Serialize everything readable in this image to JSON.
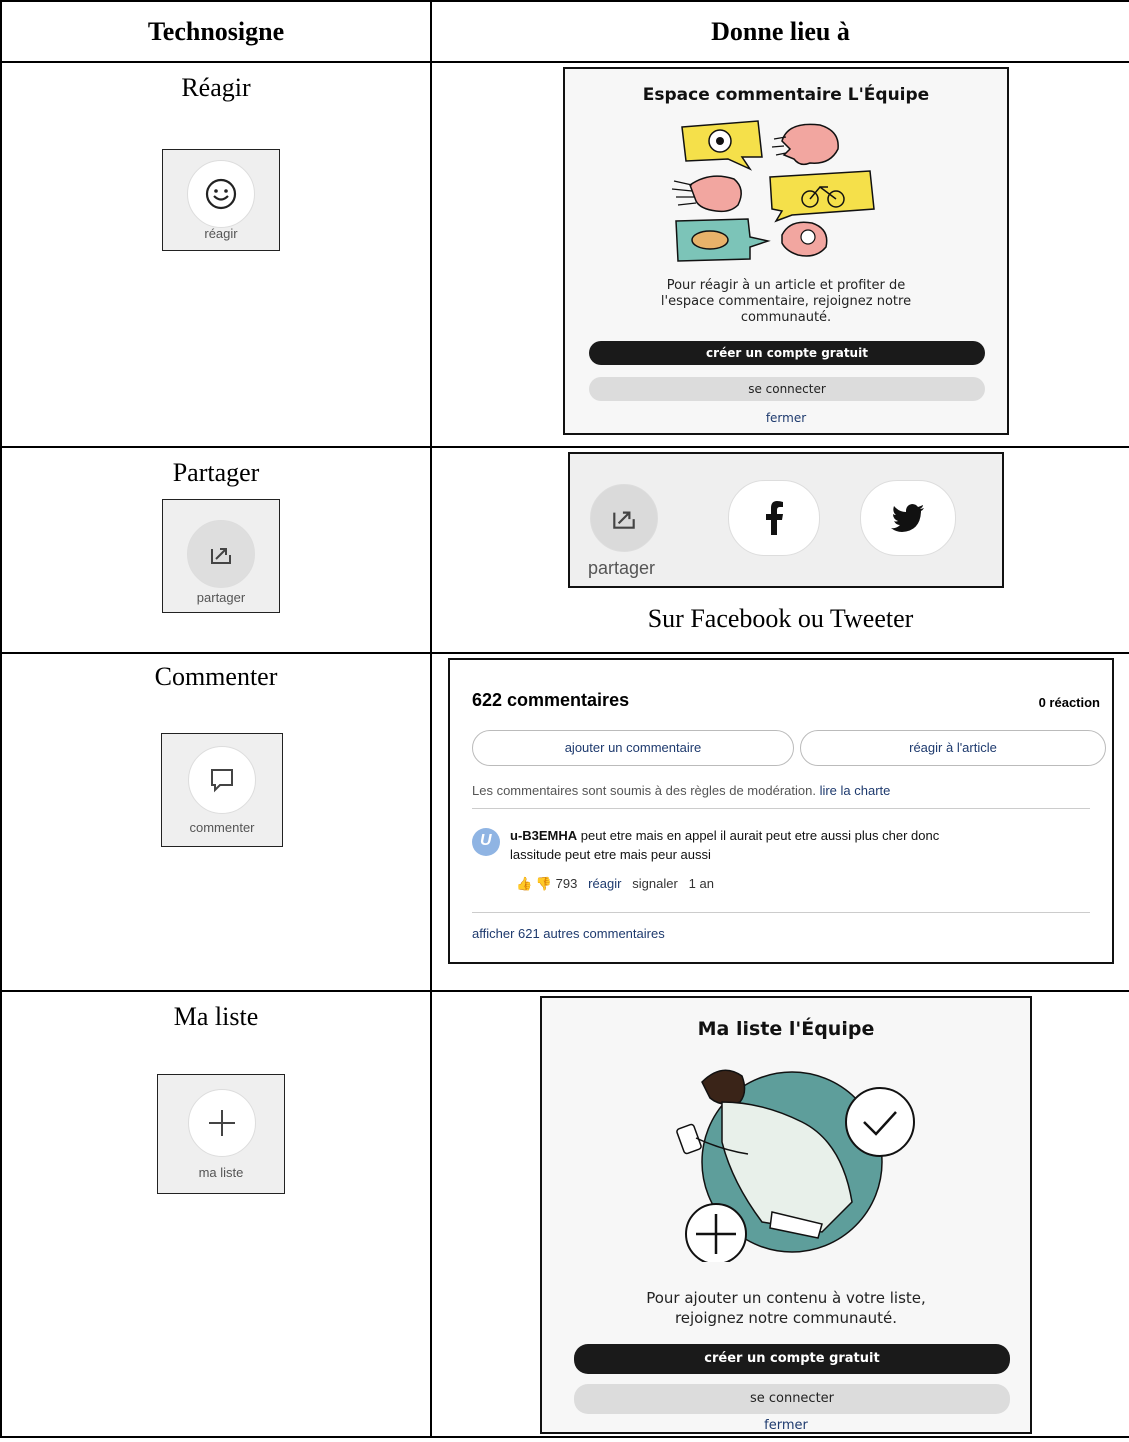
{
  "table": {
    "col1_header": "Technosigne",
    "col2_header": "Donne lieu à"
  },
  "rows": [
    {
      "label": "Réagir",
      "tech_label": "réagir",
      "panel": {
        "title": "Espace commentaire L'Équipe",
        "text": [
          "Pour réagir à un article et profiter de",
          "l'espace commentaire, rejoignez notre",
          "communauté."
        ],
        "primary_button": "créer un compte gratuit",
        "secondary_button": "se connecter",
        "close_link": "fermer"
      }
    },
    {
      "label": "Partager",
      "tech_label": "partager",
      "share": {
        "label": "partager",
        "facebook_icon": "facebook-icon",
        "twitter_icon": "twitter-icon"
      },
      "caption": "Sur Facebook ou Tweeter"
    },
    {
      "label": "Commenter",
      "tech_label": "commenter",
      "comments": {
        "count": "622 commentaires",
        "reactions": "0 réaction",
        "add_button": "ajouter un commentaire",
        "react_button": "réagir à l'article",
        "moderation_text": "Les commentaires sont soumis à des règles de modération.",
        "charter_link": "lire la charte",
        "comment": {
          "user": "u-B3EMHA",
          "text_line1": "peut etre mais en appel il aurait peut etre aussi plus cher donc",
          "text_line2": "lassitude peut etre mais peur aussi",
          "votes": "793",
          "react": "réagir",
          "report": "signaler",
          "age": "1 an"
        },
        "more_link": "afficher 621 autres commentaires"
      }
    },
    {
      "label": "Ma liste",
      "tech_label": "ma liste",
      "panel": {
        "title": "Ma liste l'Équipe",
        "text": [
          "Pour ajouter un contenu à votre liste,",
          "rejoignez notre communauté."
        ],
        "primary_button": "créer un compte gratuit",
        "secondary_button": "se connecter",
        "close_link": "fermer"
      }
    }
  ],
  "colors": {
    "speech_yellow": "#f5e04a",
    "speech_teal": "#7cc4b8",
    "face_pink": "#f2a6a0",
    "link_blue": "#1e3a6e",
    "teal_circle": "#5e9e9b"
  }
}
